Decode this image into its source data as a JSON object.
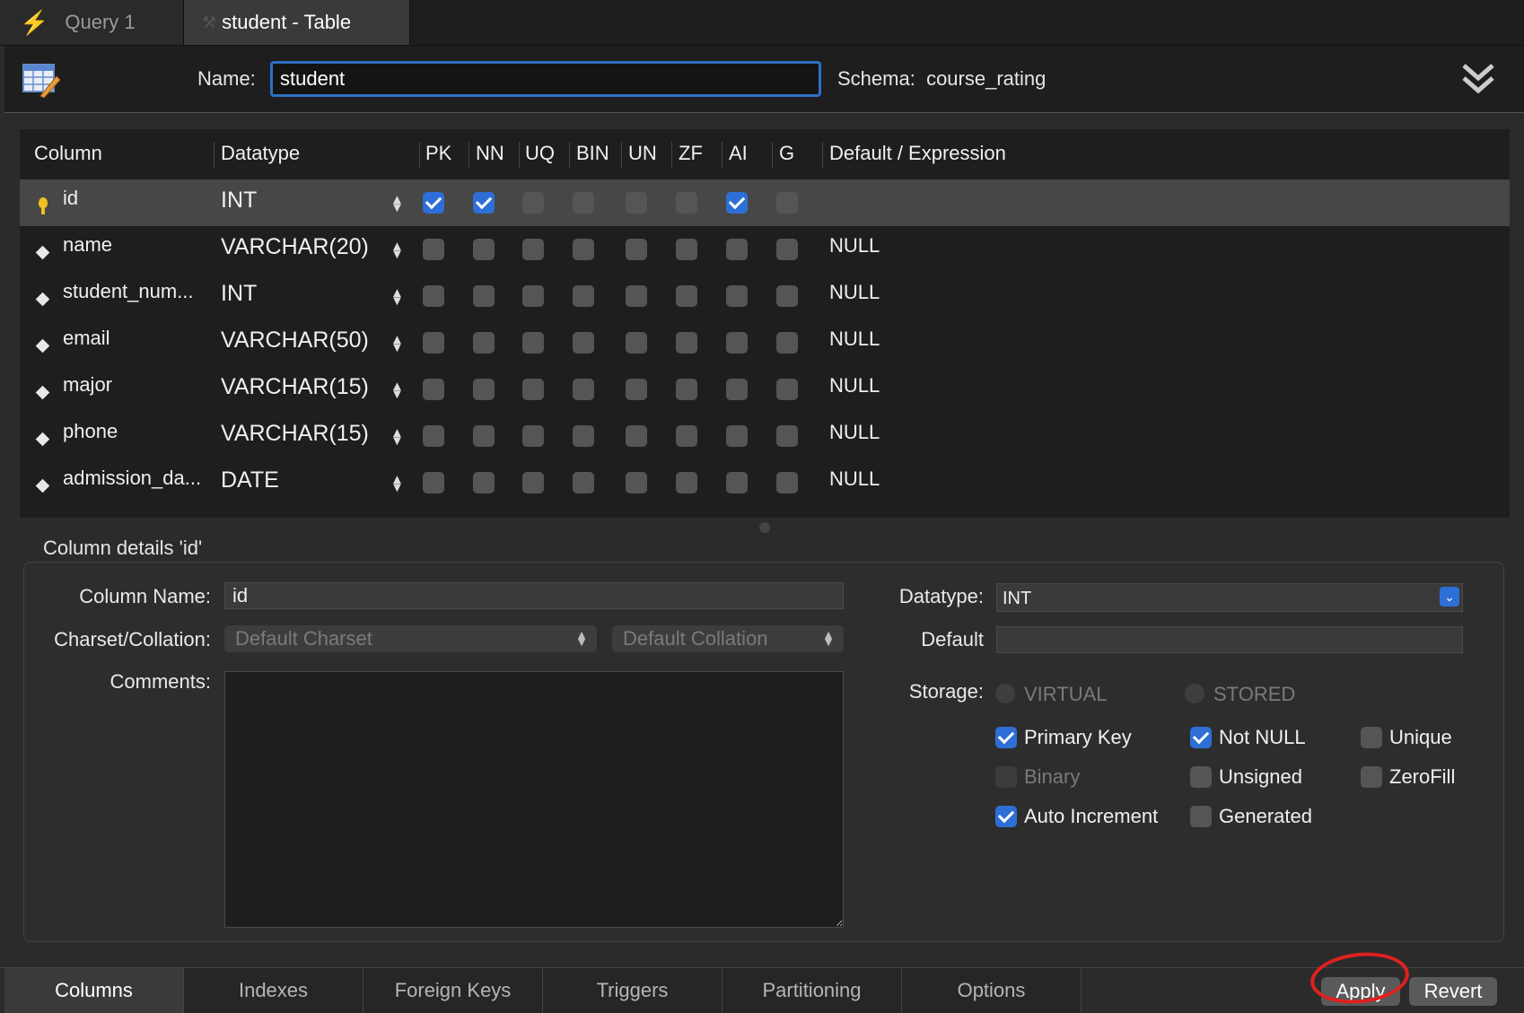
{
  "tabs": [
    {
      "label": "Query 1",
      "active": false
    },
    {
      "label": "student - Table",
      "active": true
    }
  ],
  "header": {
    "name_label": "Name:",
    "name_value": "student",
    "schema_label": "Schema:",
    "schema_value": "course_rating"
  },
  "grid": {
    "headers": [
      "Column",
      "Datatype",
      "PK",
      "NN",
      "UQ",
      "BIN",
      "UN",
      "ZF",
      "AI",
      "G",
      "Default / Expression"
    ],
    "rows": [
      {
        "name": "id",
        "datatype": "INT",
        "flags": [
          true,
          true,
          false,
          false,
          false,
          false,
          true,
          false
        ],
        "default": "",
        "key": "primary"
      },
      {
        "name": "name",
        "datatype": "VARCHAR(20)",
        "flags": [
          false,
          false,
          false,
          false,
          false,
          false,
          false,
          false
        ],
        "default": "NULL",
        "key": "column"
      },
      {
        "name": "student_num...",
        "datatype": "INT",
        "flags": [
          false,
          false,
          false,
          false,
          false,
          false,
          false,
          false
        ],
        "default": "NULL",
        "key": "column"
      },
      {
        "name": "email",
        "datatype": "VARCHAR(50)",
        "flags": [
          false,
          false,
          false,
          false,
          false,
          false,
          false,
          false
        ],
        "default": "NULL",
        "key": "column"
      },
      {
        "name": "major",
        "datatype": "VARCHAR(15)",
        "flags": [
          false,
          false,
          false,
          false,
          false,
          false,
          false,
          false
        ],
        "default": "NULL",
        "key": "column"
      },
      {
        "name": "phone",
        "datatype": "VARCHAR(15)",
        "flags": [
          false,
          false,
          false,
          false,
          false,
          false,
          false,
          false
        ],
        "default": "NULL",
        "key": "column"
      },
      {
        "name": "admission_da...",
        "datatype": "DATE",
        "flags": [
          false,
          false,
          false,
          false,
          false,
          false,
          false,
          false
        ],
        "default": "NULL",
        "key": "column"
      }
    ]
  },
  "details": {
    "title": "Column details 'id'",
    "column_name_label": "Column Name:",
    "column_name_value": "id",
    "charset_label": "Charset/Collation:",
    "charset_value": "Default Charset",
    "collation_value": "Default Collation",
    "comments_label": "Comments:",
    "datatype_label": "Datatype:",
    "datatype_value": "INT",
    "default_label": "Default",
    "default_value": "",
    "storage_label": "Storage:",
    "storage_virtual": "VIRTUAL",
    "storage_stored": "STORED",
    "options": {
      "primary_key": {
        "label": "Primary Key",
        "checked": true
      },
      "not_null": {
        "label": "Not NULL",
        "checked": true
      },
      "unique": {
        "label": "Unique",
        "checked": false
      },
      "binary": {
        "label": "Binary",
        "checked": false
      },
      "unsigned": {
        "label": "Unsigned",
        "checked": false
      },
      "zerofill": {
        "label": "ZeroFill",
        "checked": false
      },
      "auto_increment": {
        "label": "Auto Increment",
        "checked": true
      },
      "generated": {
        "label": "Generated",
        "checked": false
      }
    }
  },
  "bottom_tabs": [
    "Columns",
    "Indexes",
    "Foreign Keys",
    "Triggers",
    "Partitioning",
    "Options"
  ],
  "buttons": {
    "apply": "Apply",
    "revert": "Revert"
  },
  "colors": {
    "accent": "#2d6fd6",
    "annotation": "#e02020"
  }
}
